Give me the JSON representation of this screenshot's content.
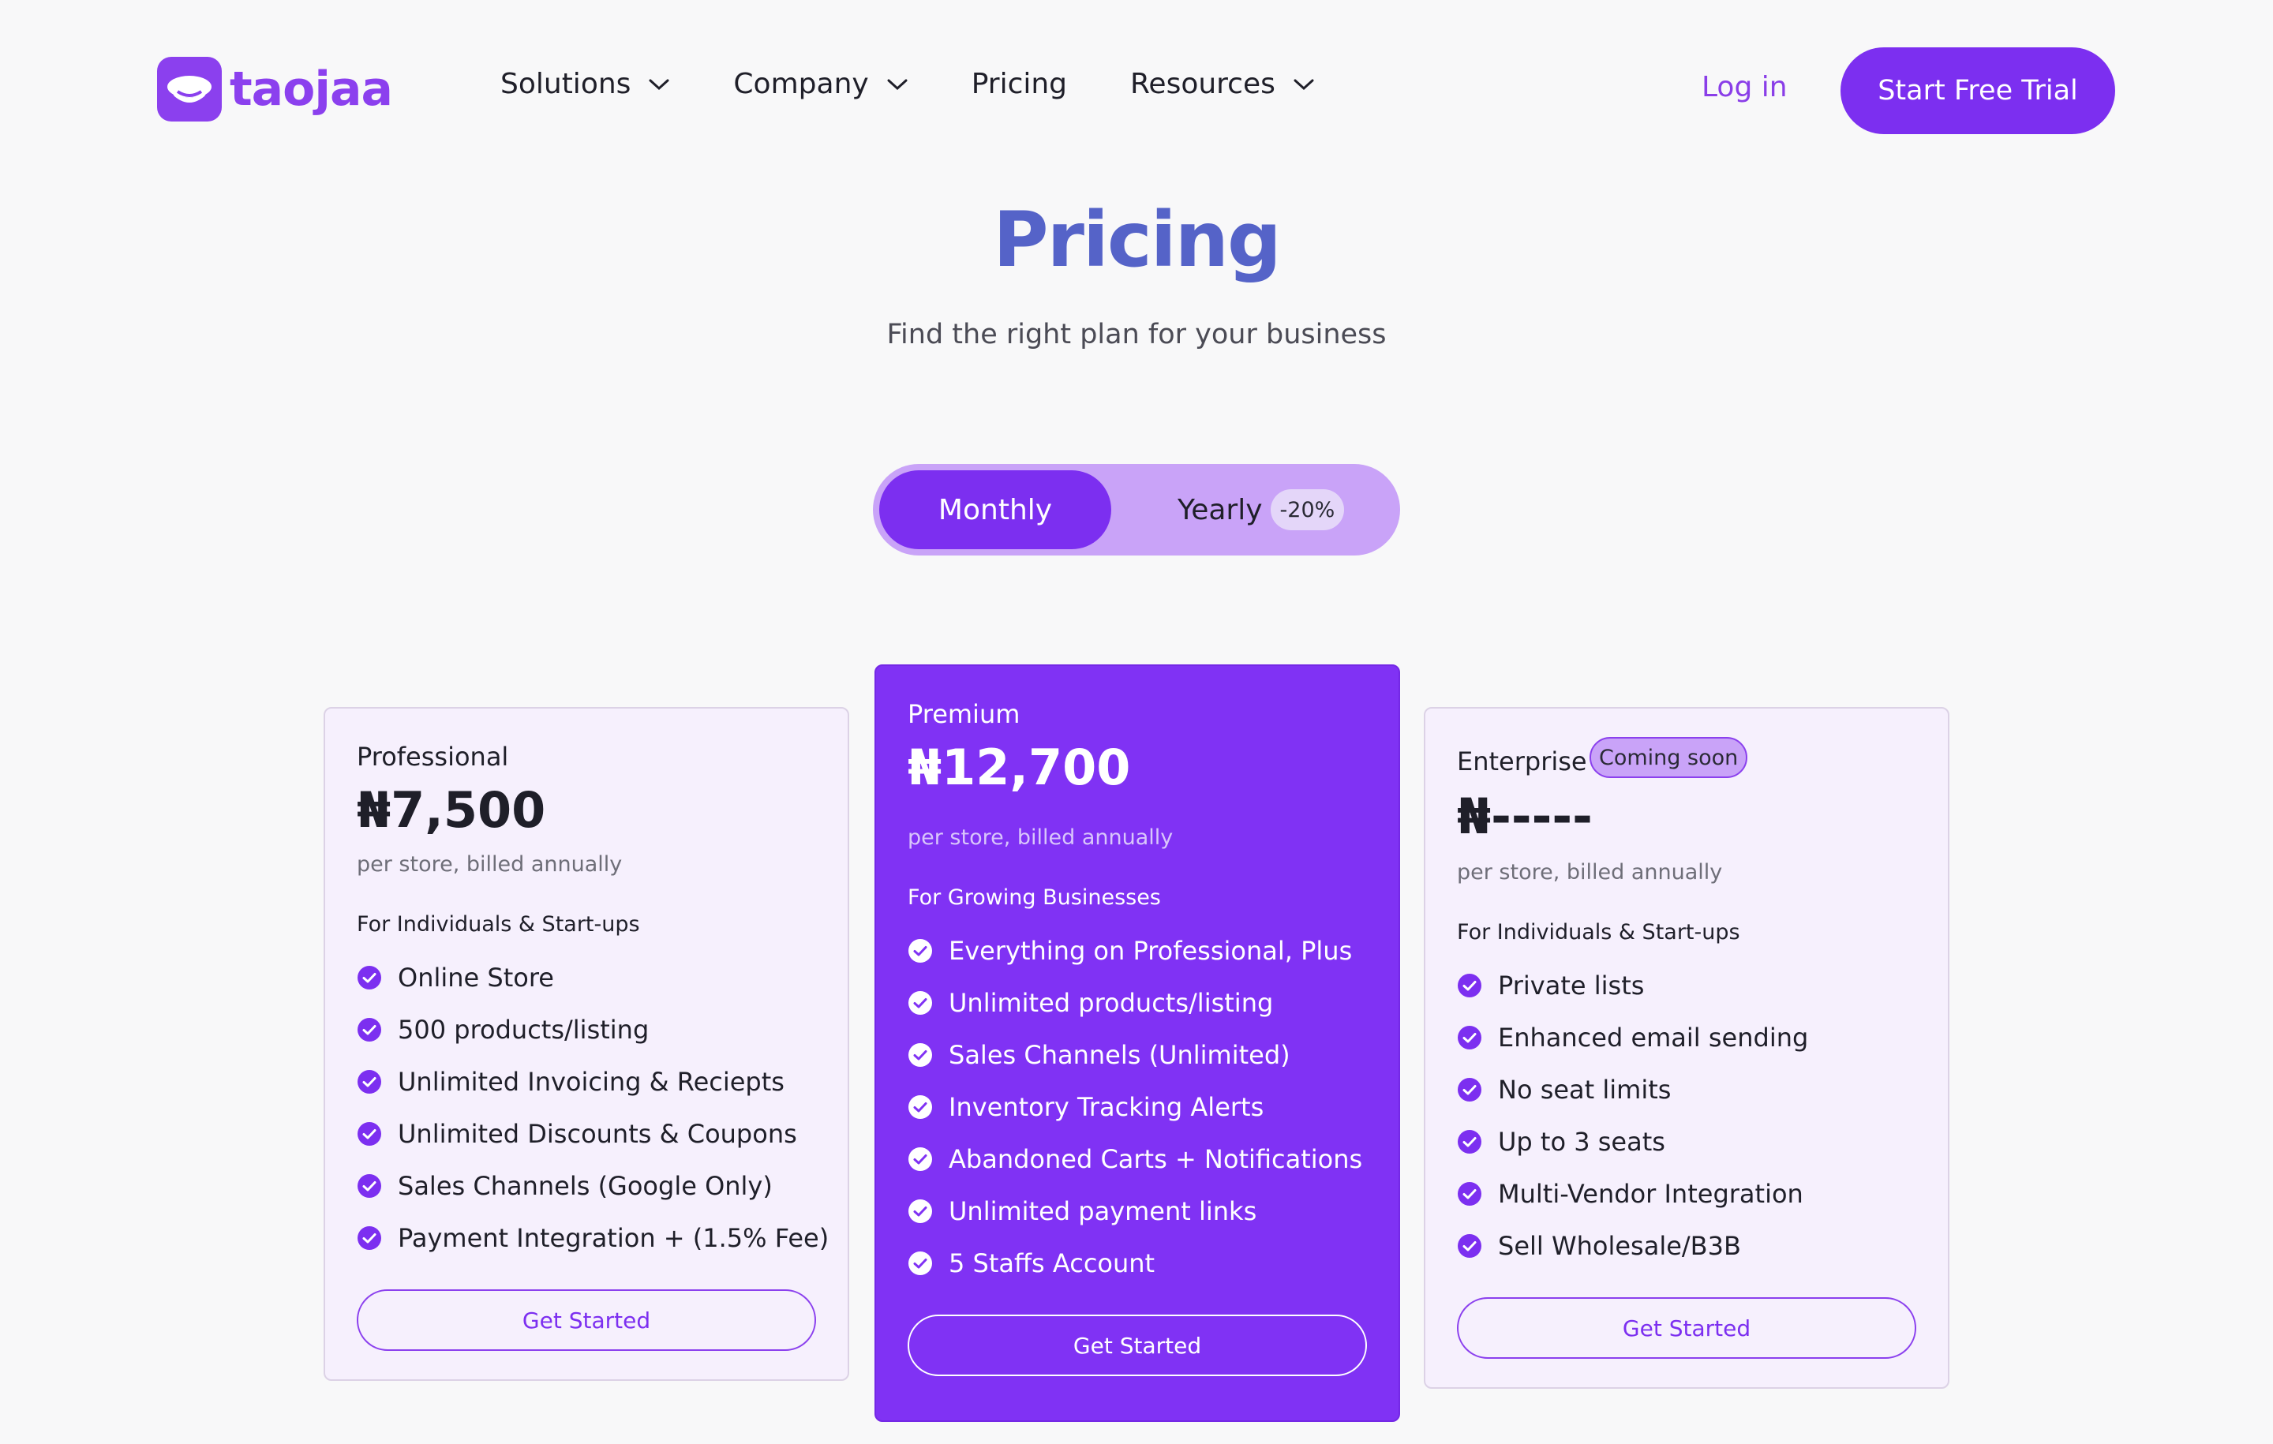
{
  "brand": {
    "name": "taojaa",
    "color": "#8b40ee"
  },
  "nav": {
    "items": [
      {
        "label": "Solutions",
        "has_dropdown": true
      },
      {
        "label": "Company",
        "has_dropdown": true
      },
      {
        "label": "Pricing",
        "has_dropdown": false
      },
      {
        "label": "Resources",
        "has_dropdown": true
      }
    ],
    "login_label": "Log in",
    "trial_label": "Start Free Trial"
  },
  "hero": {
    "title": "Pricing",
    "subtitle": "Find the right plan for your business"
  },
  "billing_toggle": {
    "selected": "Monthly",
    "monthly_label": "Monthly",
    "yearly_label": "Yearly",
    "yearly_discount": "-20%"
  },
  "plans": [
    {
      "name": "Professional",
      "price": "₦7,500",
      "billing": "per store, billed annually",
      "audience": "For Individuals & Start-ups",
      "features": [
        "Online Store",
        "500 products/listing",
        "Unlimited Invoicing & Reciepts",
        "Unlimited Discounts & Coupons",
        "Sales Channels (Google Only)",
        "Payment Integration + (1.5% Fee)"
      ],
      "cta": "Get Started"
    },
    {
      "name": "Premium",
      "price": "₦12,700",
      "billing": "per store, billed annually",
      "audience": "For Growing Businesses",
      "features": [
        "Everything on Professional, Plus",
        "Unlimited products/listing",
        "Sales Channels (Unlimited)",
        "Inventory Tracking Alerts",
        "Abandoned Carts + Notifications",
        "Unlimited payment links",
        "5 Staffs Account"
      ],
      "cta": "Get Started",
      "highlighted": true
    },
    {
      "name": "Enterprise",
      "badge": "Coming soon",
      "price": "₦-----",
      "billing": "per store, billed annually",
      "audience": "For Individuals & Start-ups",
      "features": [
        "Private lists",
        "Enhanced email sending",
        "No seat limits",
        "Up to 3 seats",
        "Multi-Vendor Integration",
        "Sell Wholesale/B3B"
      ],
      "cta": "Get Started"
    }
  ],
  "colors": {
    "accent": "#7c2ff0",
    "premium_card": "#8032f4",
    "title_blue": "#5563c8",
    "toggle_track": "#c9a3f8",
    "page_bg": "#f8f8f9"
  },
  "icons": {
    "feature_check": "check-circle-icon",
    "nav_dropdown": "chevron-down-icon"
  }
}
